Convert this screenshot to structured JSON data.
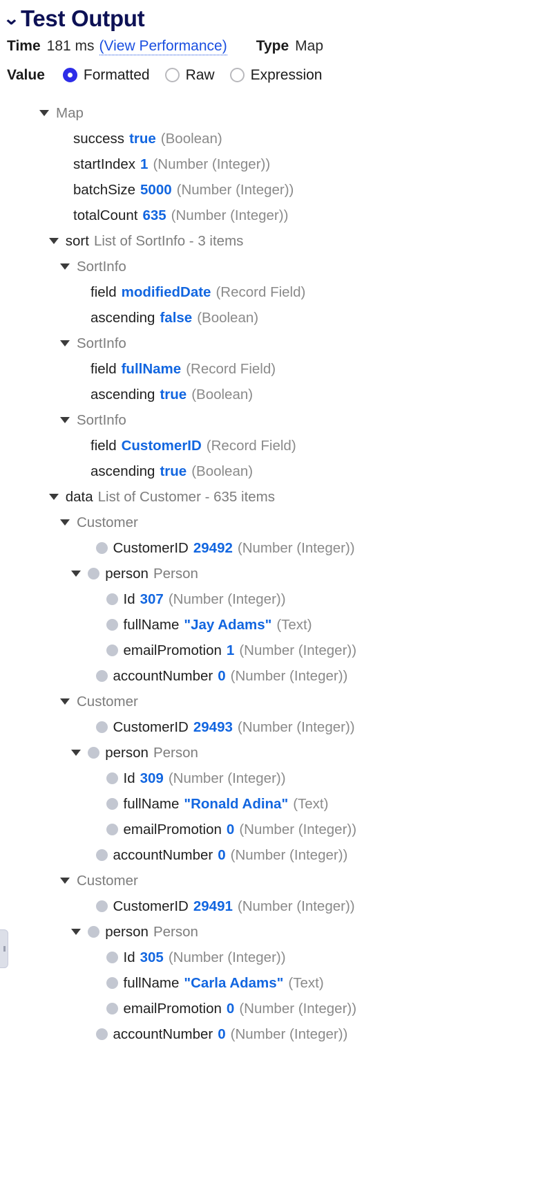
{
  "header": {
    "collapse_icon": "chevron-down-icon",
    "title": "Test Output",
    "time_label": "Time",
    "time_value": "181 ms",
    "perf_link": "(View Performance)",
    "type_label": "Type",
    "type_value": "Map",
    "value_label": "Value",
    "radios": [
      {
        "label": "Formatted",
        "selected": true
      },
      {
        "label": "Raw",
        "selected": false
      },
      {
        "label": "Expression",
        "selected": false
      }
    ],
    "accent_blue": "#1266e0",
    "radio_blue": "#2d2de8",
    "title_navy": "#0d1155"
  },
  "tree": {
    "rows": [
      {
        "indent": 1,
        "caret": true,
        "bullet": false,
        "name": "Map",
        "name_style": "muted",
        "value": "",
        "type": ""
      },
      {
        "indent": 2,
        "caret": false,
        "bullet": false,
        "name": "success",
        "name_style": "name",
        "value": "true",
        "type": "(Boolean)"
      },
      {
        "indent": 2,
        "caret": false,
        "bullet": false,
        "name": "startIndex",
        "name_style": "name",
        "value": "1",
        "type": "(Number (Integer))"
      },
      {
        "indent": 2,
        "caret": false,
        "bullet": false,
        "name": "batchSize",
        "name_style": "name",
        "value": "5000",
        "type": "(Number (Integer))"
      },
      {
        "indent": 2,
        "caret": false,
        "bullet": false,
        "name": "totalCount",
        "name_style": "name",
        "value": "635",
        "type": "(Number (Integer))"
      },
      {
        "indent": 1.55,
        "caret": true,
        "bullet": false,
        "name": "sort",
        "name_style": "name",
        "meta": "List of SortInfo - 3 items",
        "value": "",
        "type": ""
      },
      {
        "indent": 2.2,
        "caret": true,
        "bullet": false,
        "name": "SortInfo",
        "name_style": "muted",
        "value": "",
        "type": ""
      },
      {
        "indent": 3,
        "caret": false,
        "bullet": false,
        "name": "field",
        "name_style": "name",
        "value": "modifiedDate",
        "type": "(Record Field)"
      },
      {
        "indent": 3,
        "caret": false,
        "bullet": false,
        "name": "ascending",
        "name_style": "name",
        "value": "false",
        "type": "(Boolean)"
      },
      {
        "indent": 2.2,
        "caret": true,
        "bullet": false,
        "name": "SortInfo",
        "name_style": "muted",
        "value": "",
        "type": ""
      },
      {
        "indent": 3,
        "caret": false,
        "bullet": false,
        "name": "field",
        "name_style": "name",
        "value": "fullName",
        "type": "(Record Field)"
      },
      {
        "indent": 3,
        "caret": false,
        "bullet": false,
        "name": "ascending",
        "name_style": "name",
        "value": "true",
        "type": "(Boolean)"
      },
      {
        "indent": 2.2,
        "caret": true,
        "bullet": false,
        "name": "SortInfo",
        "name_style": "muted",
        "value": "",
        "type": ""
      },
      {
        "indent": 3,
        "caret": false,
        "bullet": false,
        "name": "field",
        "name_style": "name",
        "value": "CustomerID",
        "type": "(Record Field)"
      },
      {
        "indent": 3,
        "caret": false,
        "bullet": false,
        "name": "ascending",
        "name_style": "name",
        "value": "true",
        "type": "(Boolean)"
      },
      {
        "indent": 1.55,
        "caret": true,
        "bullet": false,
        "name": "data",
        "name_style": "name",
        "meta": "List of Customer - 635 items",
        "value": "",
        "type": ""
      },
      {
        "indent": 2.2,
        "caret": true,
        "bullet": false,
        "name": "Customer",
        "name_style": "muted",
        "value": "",
        "type": ""
      },
      {
        "indent": 3.3,
        "caret": false,
        "bullet": true,
        "name": "CustomerID",
        "name_style": "name",
        "value": "29492",
        "type": "(Number (Integer))"
      },
      {
        "indent": 2.85,
        "caret": true,
        "bullet": true,
        "name": "person",
        "name_style": "name",
        "meta": "Person",
        "value": "",
        "type": ""
      },
      {
        "indent": 3.9,
        "caret": false,
        "bullet": true,
        "name": "Id",
        "name_style": "name",
        "value": "307",
        "type": "(Number (Integer))"
      },
      {
        "indent": 3.9,
        "caret": false,
        "bullet": true,
        "name": "fullName",
        "name_style": "name",
        "value": "\"Jay Adams\"",
        "type": "(Text)"
      },
      {
        "indent": 3.9,
        "caret": false,
        "bullet": true,
        "name": "emailPromotion",
        "name_style": "name",
        "value": "1",
        "type": "(Number (Integer))"
      },
      {
        "indent": 3.3,
        "caret": false,
        "bullet": true,
        "name": "accountNumber",
        "name_style": "name",
        "value": "0",
        "type": "(Number (Integer))"
      },
      {
        "indent": 2.2,
        "caret": true,
        "bullet": false,
        "name": "Customer",
        "name_style": "muted",
        "value": "",
        "type": ""
      },
      {
        "indent": 3.3,
        "caret": false,
        "bullet": true,
        "name": "CustomerID",
        "name_style": "name",
        "value": "29493",
        "type": "(Number (Integer))"
      },
      {
        "indent": 2.85,
        "caret": true,
        "bullet": true,
        "name": "person",
        "name_style": "name",
        "meta": "Person",
        "value": "",
        "type": ""
      },
      {
        "indent": 3.9,
        "caret": false,
        "bullet": true,
        "name": "Id",
        "name_style": "name",
        "value": "309",
        "type": "(Number (Integer))"
      },
      {
        "indent": 3.9,
        "caret": false,
        "bullet": true,
        "name": "fullName",
        "name_style": "name",
        "value": "\"Ronald Adina\"",
        "type": "(Text)"
      },
      {
        "indent": 3.9,
        "caret": false,
        "bullet": true,
        "name": "emailPromotion",
        "name_style": "name",
        "value": "0",
        "type": "(Number (Integer))"
      },
      {
        "indent": 3.3,
        "caret": false,
        "bullet": true,
        "name": "accountNumber",
        "name_style": "name",
        "value": "0",
        "type": "(Number (Integer))"
      },
      {
        "indent": 2.2,
        "caret": true,
        "bullet": false,
        "name": "Customer",
        "name_style": "muted",
        "value": "",
        "type": ""
      },
      {
        "indent": 3.3,
        "caret": false,
        "bullet": true,
        "name": "CustomerID",
        "name_style": "name",
        "value": "29491",
        "type": "(Number (Integer))"
      },
      {
        "indent": 2.85,
        "caret": true,
        "bullet": true,
        "name": "person",
        "name_style": "name",
        "meta": "Person",
        "value": "",
        "type": ""
      },
      {
        "indent": 3.9,
        "caret": false,
        "bullet": true,
        "name": "Id",
        "name_style": "name",
        "value": "305",
        "type": "(Number (Integer))"
      },
      {
        "indent": 3.9,
        "caret": false,
        "bullet": true,
        "name": "fullName",
        "name_style": "name",
        "value": "\"Carla Adams\"",
        "type": "(Text)"
      },
      {
        "indent": 3.9,
        "caret": false,
        "bullet": true,
        "name": "emailPromotion",
        "name_style": "name",
        "value": "0",
        "type": "(Number (Integer))"
      },
      {
        "indent": 3.3,
        "caret": false,
        "bullet": true,
        "name": "accountNumber",
        "name_style": "name",
        "value": "0",
        "type": "(Number (Integer))"
      }
    ]
  }
}
